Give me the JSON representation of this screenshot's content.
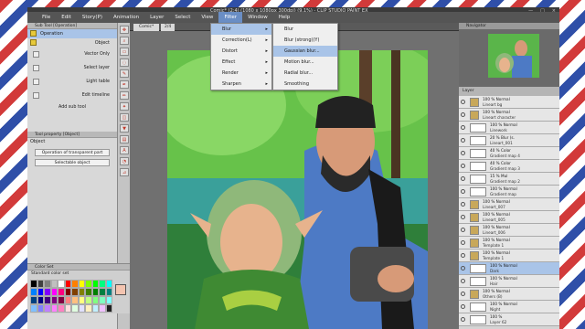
{
  "window": {
    "title": "Comic* (2:4) (1080 x 1080px 300dpi) (9.1%) - CLIP STUDIO PAINT EX",
    "buttons": [
      "—",
      "□",
      "×"
    ]
  },
  "menu": [
    "File",
    "Edit",
    "Story(P)",
    "Animation",
    "Layer",
    "Select",
    "View",
    "Filter",
    "Window",
    "Help"
  ],
  "menu_active": "Filter",
  "left": {
    "subtool_header": "Sub Tool [Operation]",
    "subtools": [
      "Operation",
      "Object"
    ],
    "options": [
      "Vector Only",
      "Select layer",
      "Light table",
      "Edit timeline"
    ],
    "add_sub_tool": "Add sub tool",
    "tool_property_header": "Tool property [Object]",
    "tool_property_label": "Object",
    "fields": [
      "Operation of transparent part",
      "Selectable object"
    ],
    "colorset_header": "Color Set",
    "colorset_name": "Standard color set",
    "swatches": [
      "#000000",
      "#404040",
      "#808080",
      "#c0c0c0",
      "#ffffff",
      "#ff0000",
      "#ff8000",
      "#ffff00",
      "#80ff00",
      "#00ff00",
      "#00ff80",
      "#00ffff",
      "#0080ff",
      "#0000ff",
      "#8000ff",
      "#ff00ff",
      "#ff0080",
      "#800000",
      "#804000",
      "#808000",
      "#408000",
      "#008000",
      "#008040",
      "#008080",
      "#004080",
      "#000080",
      "#400080",
      "#800080",
      "#800040",
      "#ff8080",
      "#ffc080",
      "#ffff80",
      "#c0ff80",
      "#80ff80",
      "#80ffc0",
      "#80ffff",
      "#80c0ff",
      "#8080ff",
      "#c080ff",
      "#ff80ff",
      "#ff80c0",
      "#ffe0e0",
      "#e0ffe0",
      "#e0e0ff",
      "#fff0c0",
      "#c0f0ff",
      "#f0c0ff",
      "#202020"
    ],
    "main_color": "#f3c4b0"
  },
  "canvas": {
    "tab": "Comic*",
    "zoom": "2/4"
  },
  "filter_menu": [
    "Blur",
    "Correction(L)",
    "Distort",
    "Effect",
    "Render",
    "Sharpen"
  ],
  "filter_menu_highlight": "Blur",
  "blur_menu": [
    "Blur",
    "Blur (strong)(Y)",
    "Gaussian blur...",
    "Motion blur...",
    "Radial blur...",
    "Smoothing"
  ],
  "blur_menu_highlight": "Gaussian blur...",
  "right": {
    "navigator_header": "Navigator",
    "layers_header": "Layer",
    "layers": [
      {
        "l1": "100 % Normal",
        "l2": "Lineart bg",
        "folder": true
      },
      {
        "l1": "100 % Normal",
        "l2": "Lineart character",
        "folder": true
      },
      {
        "l1": "100 % Normal",
        "l2": "Linework",
        "folder": false
      },
      {
        "l1": "20 % Blur (s.",
        "l2": "Lineart_001",
        "folder": false
      },
      {
        "l1": "40 % Color",
        "l2": "Gradient map 4",
        "folder": false
      },
      {
        "l1": "40 % Color",
        "l2": "Gradient map 3",
        "folder": false
      },
      {
        "l1": "15 % Mul",
        "l2": "Gradient map 2",
        "folder": false
      },
      {
        "l1": "100 % Normal",
        "l2": "Gradient map",
        "folder": false
      },
      {
        "l1": "100 % Normal",
        "l2": "Lineart_007",
        "folder": true
      },
      {
        "l1": "100 % Normal",
        "l2": "Lineart_005",
        "folder": true
      },
      {
        "l1": "100 % Normal",
        "l2": "Lineart_006",
        "folder": true
      },
      {
        "l1": "100 % Normal",
        "l2": "Template 1",
        "folder": true
      },
      {
        "l1": "100 % Normal",
        "l2": "Template 1",
        "folder": true
      },
      {
        "l1": "100 % Normal",
        "l2": "Dark",
        "folder": false
      },
      {
        "l1": "100 % Normal",
        "l2": "Hair",
        "folder": false
      },
      {
        "l1": "100 % Normal",
        "l2": "Others (B)",
        "folder": true
      },
      {
        "l1": "100 % Normal",
        "l2": "Night",
        "folder": false
      },
      {
        "l1": "100 %",
        "l2": "Layer 62",
        "folder": false
      }
    ],
    "selected_layer": 13
  }
}
